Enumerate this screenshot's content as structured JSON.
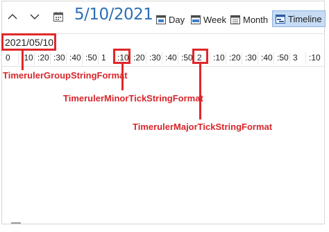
{
  "toolbar": {
    "prev_icon": "chevron-up-icon",
    "next_icon": "chevron-down-icon",
    "calendar_icon": "calendar-icon",
    "current_date": "5/10/2021",
    "views": [
      {
        "label": "Day",
        "icon": "day-view-icon",
        "active": false
      },
      {
        "label": "Week",
        "icon": "week-view-icon",
        "active": false
      },
      {
        "label": "Month",
        "icon": "month-view-icon",
        "active": false
      },
      {
        "label": "Timeline",
        "icon": "timeline-view-icon",
        "active": true
      }
    ]
  },
  "timeruler": {
    "group_label": "2021/05/10",
    "ticks": [
      "0",
      ":10",
      ":20",
      ":30",
      ":40",
      ":50",
      "1",
      ":10",
      ":20",
      ":30",
      ":40",
      ":50",
      "2",
      ":10",
      ":20",
      ":30",
      ":40",
      ":50",
      "3",
      ":10"
    ]
  },
  "callouts": {
    "group_format": "TimerulerGroupStringFormat",
    "minor_tick_format": "TimerulerMinorTickStringFormat",
    "major_tick_format": "TimerulerMajorTickStringFormat"
  },
  "colors": {
    "accent": "#2b6fb6",
    "highlight": "#e0272a",
    "active_view_bg": "#c7dcf4"
  }
}
